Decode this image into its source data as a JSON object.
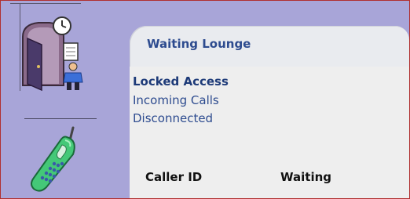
{
  "lounge": {
    "title": "Waiting Lounge",
    "menu": [
      {
        "label": "Locked Access",
        "active": true
      },
      {
        "label": "Incoming Calls",
        "active": false
      },
      {
        "label": "Disconnected",
        "active": false
      }
    ],
    "columns": [
      "Caller ID",
      "Waiting"
    ]
  },
  "icons": {
    "door": "door-exit-clock-icon",
    "phone": "mobile-phone-icon"
  },
  "colors": {
    "background": "#a8a5d8",
    "panel": "#eeeeee",
    "link": "#2d4b8f",
    "frame_border": "#b03030"
  }
}
